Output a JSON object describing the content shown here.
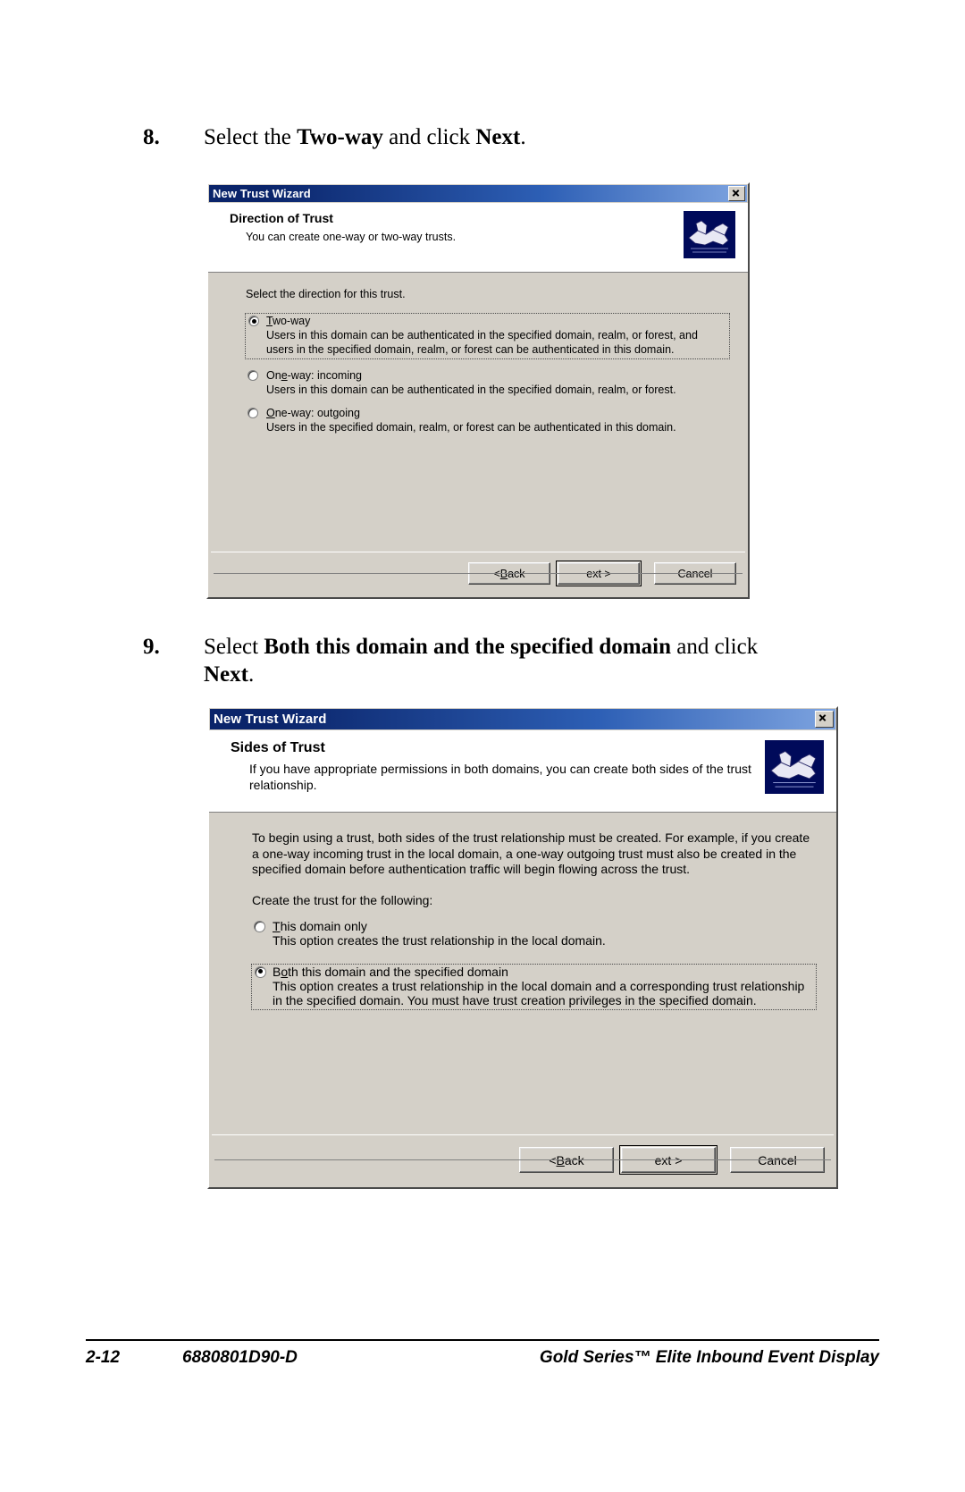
{
  "document": {
    "steps": [
      {
        "number": "8.",
        "parts": [
          {
            "text": "Select the ",
            "bold": false
          },
          {
            "text": "Two-way",
            "bold": true
          },
          {
            "text": " and click ",
            "bold": false
          },
          {
            "text": "Next",
            "bold": true
          },
          {
            "text": ".",
            "bold": false
          }
        ]
      },
      {
        "number": "9.",
        "parts": [
          {
            "text": "Select ",
            "bold": false
          },
          {
            "text": "Both this domain and the specified domain",
            "bold": true
          },
          {
            "text": " and click ",
            "bold": false
          },
          {
            "text": "Next",
            "bold": true
          },
          {
            "text": ".",
            "bold": false
          }
        ]
      }
    ],
    "footer": {
      "page_number": "2-12",
      "document_number": "6880801D90-D",
      "title": "Gold Series™ Elite Inbound Event Display"
    }
  },
  "dialog1": {
    "title": "New Trust Wizard",
    "close_label": "×",
    "header_title": "Direction of Trust",
    "header_subtitle": "You can create one-way or two-way trusts.",
    "intro": "Select the direction for this trust.",
    "options": [
      {
        "label": "Two-way",
        "accel": "T",
        "rest": "wo-way",
        "description": "Users in this domain can be authenticated in the specified domain, realm, or forest, and users in the specified domain, realm, or forest can be authenticated in this domain.",
        "selected": true,
        "framed": true
      },
      {
        "label": "One-way: incoming",
        "accel": "e",
        "pre": "On",
        "rest": "-way: incoming",
        "description": "Users in this domain can be authenticated in the specified domain, realm, or forest.",
        "selected": false,
        "framed": false
      },
      {
        "label": "One-way: outgoing",
        "accel": "O",
        "rest": "ne-way: outgoing",
        "description": "Users in the specified domain, realm, or forest can be authenticated in this domain.",
        "selected": false,
        "framed": false
      }
    ],
    "buttons": {
      "back": "< Back",
      "back_accel": "B",
      "next": "Next >",
      "next_accel": "N",
      "cancel": "Cancel"
    }
  },
  "dialog2": {
    "title": "New Trust Wizard",
    "close_label": "×",
    "header_title": "Sides of Trust",
    "header_subtitle": "If you have appropriate permissions in both domains, you can create both sides of the trust relationship.",
    "body_paragraph": "To begin using a trust, both sides of the trust relationship must be created. For example, if you create a one-way incoming trust in the local domain, a one-way outgoing trust must also be created in the specified domain before authentication traffic will begin flowing across the trust.",
    "intro": "Create the trust for the following:",
    "options": [
      {
        "label": "This domain only",
        "accel": "T",
        "rest": "his domain only",
        "description": "This option creates the trust relationship in the local domain.",
        "selected": false,
        "framed": false
      },
      {
        "label": "Both this domain and the specified domain",
        "accel": "o",
        "pre": "B",
        "rest": "th this domain and the specified domain",
        "description": "This option creates a trust relationship in the local domain and a corresponding trust relationship in the specified domain. You must have trust creation privileges in the specified domain.",
        "selected": true,
        "framed": true
      }
    ],
    "buttons": {
      "back": "< Back",
      "back_accel": "B",
      "next": "Next >",
      "next_accel": "N",
      "cancel": "Cancel"
    }
  },
  "colors": {
    "titlebar_start": "#0a246a",
    "titlebar_end": "#7ea4e0",
    "dialog_face": "#d4d0c8",
    "icon_background": "#000a5a"
  }
}
